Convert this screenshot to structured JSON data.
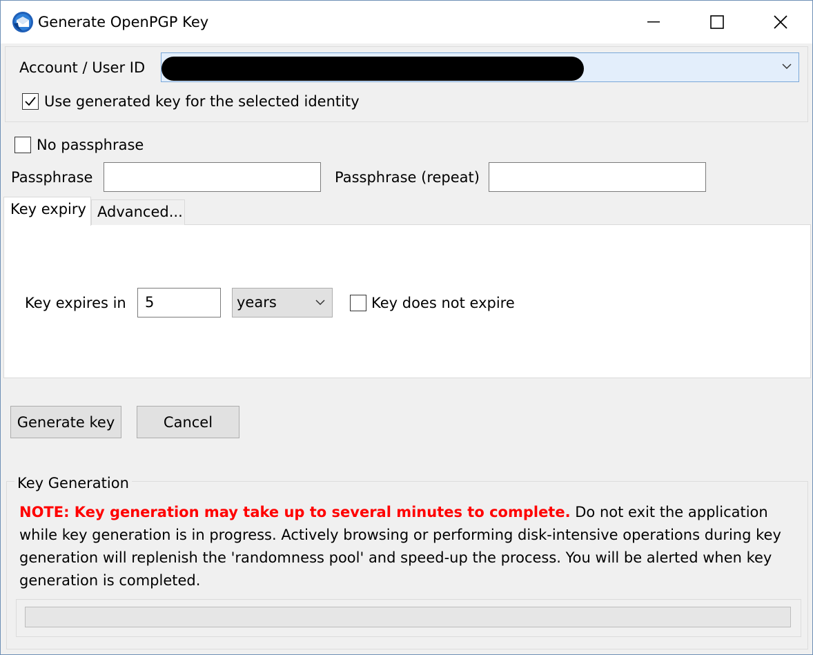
{
  "window": {
    "title": "Generate OpenPGP Key"
  },
  "account": {
    "label": "Account / User ID",
    "selected_value": "",
    "use_generated_key_label": "Use generated key for the selected identity",
    "use_generated_key_checked": true
  },
  "passphrase": {
    "no_passphrase_label": "No passphrase",
    "no_passphrase_checked": false,
    "passphrase_label": "Passphrase",
    "passphrase_value": "",
    "repeat_label": "Passphrase (repeat)",
    "repeat_value": ""
  },
  "tabs": [
    {
      "label": "Key expiry",
      "active": true
    },
    {
      "label": "Advanced...",
      "active": false
    }
  ],
  "expiry": {
    "label": "Key expires in",
    "value": "5",
    "unit": "years",
    "no_expire_label": "Key does not expire",
    "no_expire_checked": false
  },
  "buttons": {
    "generate": "Generate key",
    "cancel": "Cancel"
  },
  "generation": {
    "legend": "Key Generation",
    "note_warning": "NOTE: Key generation may take up to several minutes to complete.",
    "note_text": " Do not exit the application while key generation is in progress. Actively browsing or performing disk-intensive operations during key generation will replenish the 'randomness pool' and speed-up the process. You will be alerted when key generation is completed.",
    "progress": 0
  },
  "icons": {
    "app": "thunderbird-icon",
    "minimize": "minimize-icon",
    "maximize": "maximize-icon",
    "close": "close-icon",
    "dropdown": "chevron-down-icon",
    "checkmark": "checkmark-icon"
  }
}
